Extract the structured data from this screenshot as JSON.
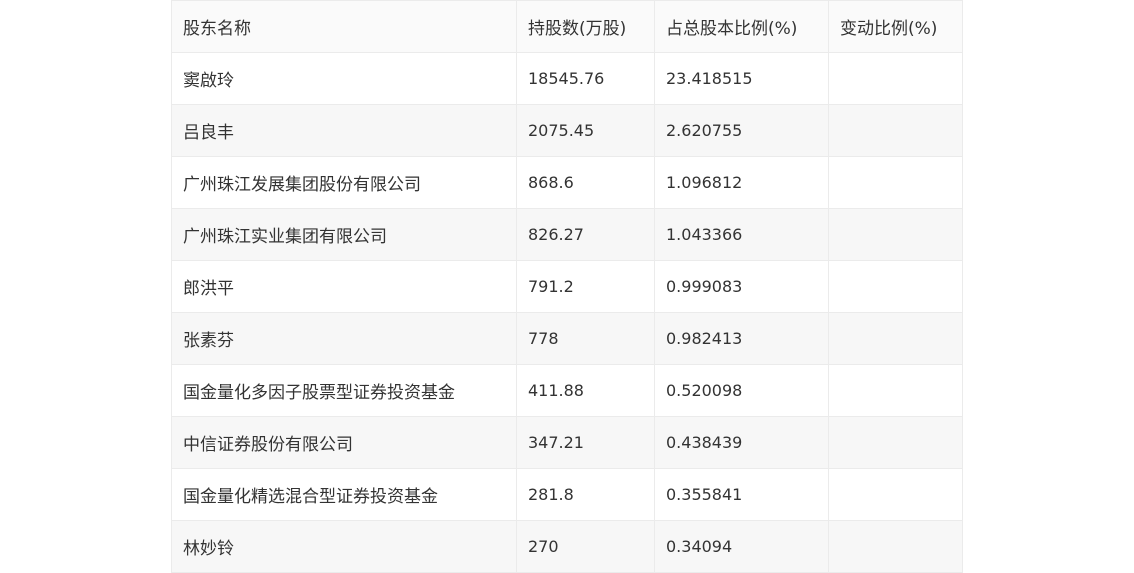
{
  "table": {
    "headers": [
      "股东名称",
      "持股数(万股)",
      "占总股本比例(%)",
      "变动比例(%)"
    ],
    "rows": [
      [
        "窦啟玲",
        "18545.76",
        "23.418515",
        ""
      ],
      [
        "吕良丰",
        "2075.45",
        "2.620755",
        ""
      ],
      [
        "广州珠江发展集团股份有限公司",
        "868.6",
        "1.096812",
        ""
      ],
      [
        "广州珠江实业集团有限公司",
        "826.27",
        "1.043366",
        ""
      ],
      [
        "郎洪平",
        "791.2",
        "0.999083",
        ""
      ],
      [
        "张素芬",
        "778",
        "0.982413",
        ""
      ],
      [
        "国金量化多因子股票型证券投资基金",
        "411.88",
        "0.520098",
        ""
      ],
      [
        "中信证券股份有限公司",
        "347.21",
        "0.438439",
        ""
      ],
      [
        "国金量化精选混合型证券投资基金",
        "281.8",
        "0.355841",
        ""
      ],
      [
        "林妙铃",
        "270",
        "0.34094",
        ""
      ]
    ]
  }
}
